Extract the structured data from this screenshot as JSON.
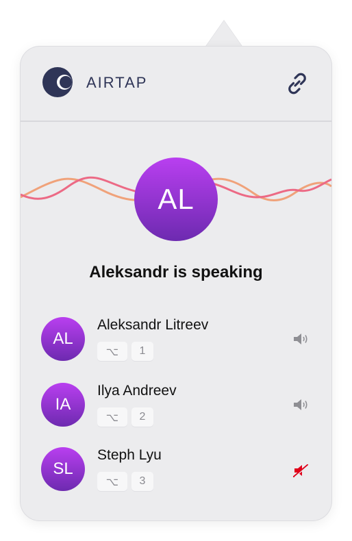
{
  "header": {
    "brand": "AIRTAP"
  },
  "current_speaker": {
    "initials": "AL",
    "status_text": "Aleksandr is speaking"
  },
  "participants": [
    {
      "initials": "AL",
      "name": "Aleksandr Litreev",
      "key_symbol": "⌥",
      "key_number": "1",
      "audio": "on"
    },
    {
      "initials": "IA",
      "name": "Ilya Andreev",
      "key_symbol": "⌥",
      "key_number": "2",
      "audio": "on"
    },
    {
      "initials": "SL",
      "name": "Steph Lyu",
      "key_symbol": "⌥",
      "key_number": "3",
      "audio": "muted"
    }
  ],
  "colors": {
    "avatar_gradient_top": "#b93ff0",
    "avatar_gradient_bottom": "#6d2ab0",
    "brand_navy": "#2f3557",
    "wave_pink": "#ec6a85",
    "wave_orange": "#f0a27a",
    "muted_red": "#e0001a",
    "speaker_gray": "#8e8e93"
  },
  "icons": {
    "logo": "airtap-logo-icon",
    "link": "link-icon",
    "speaker_on": "speaker-volume-icon",
    "speaker_muted": "speaker-muted-icon"
  }
}
